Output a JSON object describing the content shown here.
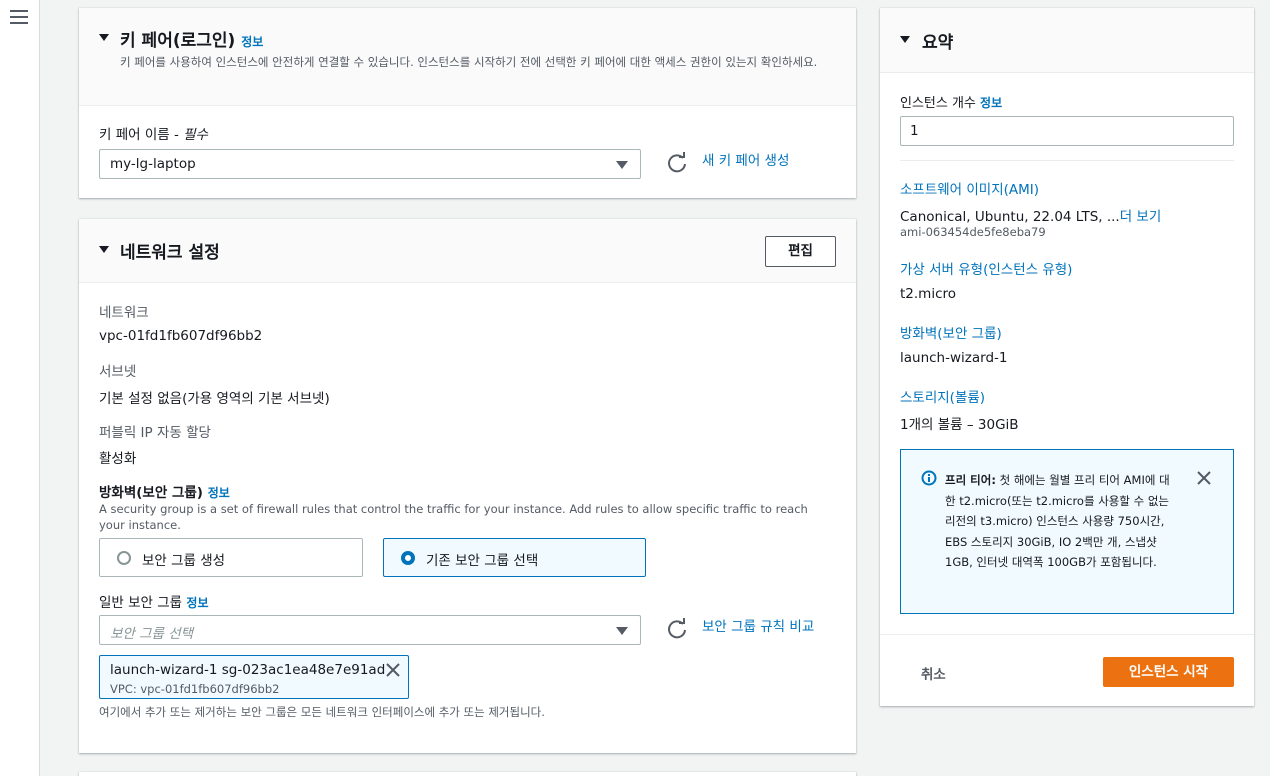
{
  "keypair": {
    "title": "키 페어(로그인)",
    "info": "정보",
    "description": "키 페어를 사용하여 인스턴스에 안전하게 연결할 수 있습니다. 인스턴스를 시작하기 전에 선택한 키 페어에 대한 액세스 권한이 있는지 확인하세요.",
    "field_label": "키 페어 이름 - ",
    "field_required": "필수",
    "selected": "my-lg-laptop",
    "create_link": "새 키 페어 생성"
  },
  "network": {
    "title": "네트워크 설정",
    "edit_button": "편집",
    "network_label": "네트워크",
    "network_value": "vpc-01fd1fb607df96bb2",
    "subnet_label": "서브넷",
    "subnet_value": "기본 설정 없음(가용 영역의 기본 서브넷)",
    "public_ip_label": "퍼블릭 IP 자동 할당",
    "public_ip_value": "활성화",
    "firewall_label": "방화벽(보안 그룹)",
    "firewall_info": "정보",
    "firewall_desc": "A security group is a set of firewall rules that control the traffic for your instance. Add rules to allow specific traffic to reach your instance.",
    "radio_create": "보안 그룹 생성",
    "radio_existing": "기존 보안 그룹 선택",
    "common_sg_label": "일반 보안 그룹",
    "common_sg_info": "정보",
    "sg_placeholder": "보안 그룹 선택",
    "compare_link": "보안 그룹 규칙 비교",
    "token_name": "launch-wizard-1   sg-023ac1ea48e7e91ad",
    "token_vpc": "VPC: vpc-01fd1fb607df96bb2",
    "footnote": "여기에서 추가 또는 제거하는 보안 그룹은 모든 네트워크 인터페이스에 추가 또는 제거됩니다."
  },
  "summary": {
    "title": "요약",
    "count_label": "인스턴스 개수",
    "count_info": "정보",
    "count_value": "1",
    "ami_label": "소프트웨어 이미지(AMI)",
    "ami_value": "Canonical, Ubuntu, 22.04 LTS, ...",
    "ami_more": "더 보기",
    "ami_id": "ami-063454de5fe8eba79",
    "type_label": "가상 서버 유형(인스턴스 유형)",
    "type_value": "t2.micro",
    "firewall_label": "방화벽(보안 그룹)",
    "firewall_value": "launch-wizard-1",
    "storage_label": "스토리지(볼륨)",
    "storage_value": "1개의 볼륨 – 30GiB",
    "freetier_bold": "프리 티어:",
    "freetier_text": " 첫 해에는 월별 프리 티어 AMI에 대한 t2.micro(또는 t2.micro를 사용할 수 없는 리전의 t3.micro) 인스턴스 사용량 750시간, EBS 스토리지 30GiB, IO 2백만 개, 스냅샷 1GB, 인터넷 대역폭 100GB가 포함됩니다.",
    "cancel": "취소",
    "launch": "인스턴스 시작"
  },
  "colors": {
    "accent": "#0073bb",
    "primary_button": "#ec7211"
  },
  "icons": [
    "menu-icon",
    "refresh-icon",
    "close-icon",
    "info-circle-icon",
    "caret-down-icon"
  ]
}
